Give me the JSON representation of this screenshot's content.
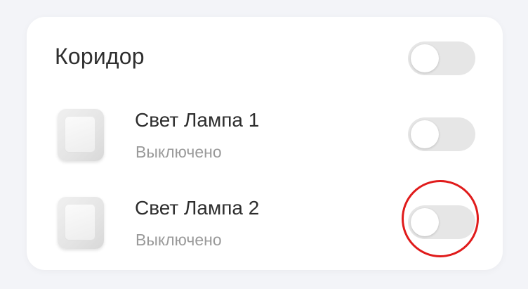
{
  "room": {
    "title": "Коридор",
    "toggle": {
      "on": false
    }
  },
  "devices": [
    {
      "name": "Свет Лампа 1",
      "status": "Выключено",
      "on": false,
      "icon": "light-switch-icon"
    },
    {
      "name": "Свет Лампа 2",
      "status": "Выключено",
      "on": false,
      "icon": "light-switch-icon"
    }
  ],
  "colors": {
    "background": "#f3f4f8",
    "card": "#ffffff",
    "toggle_off": "#e6e6e6",
    "highlight": "#e01b1b"
  }
}
